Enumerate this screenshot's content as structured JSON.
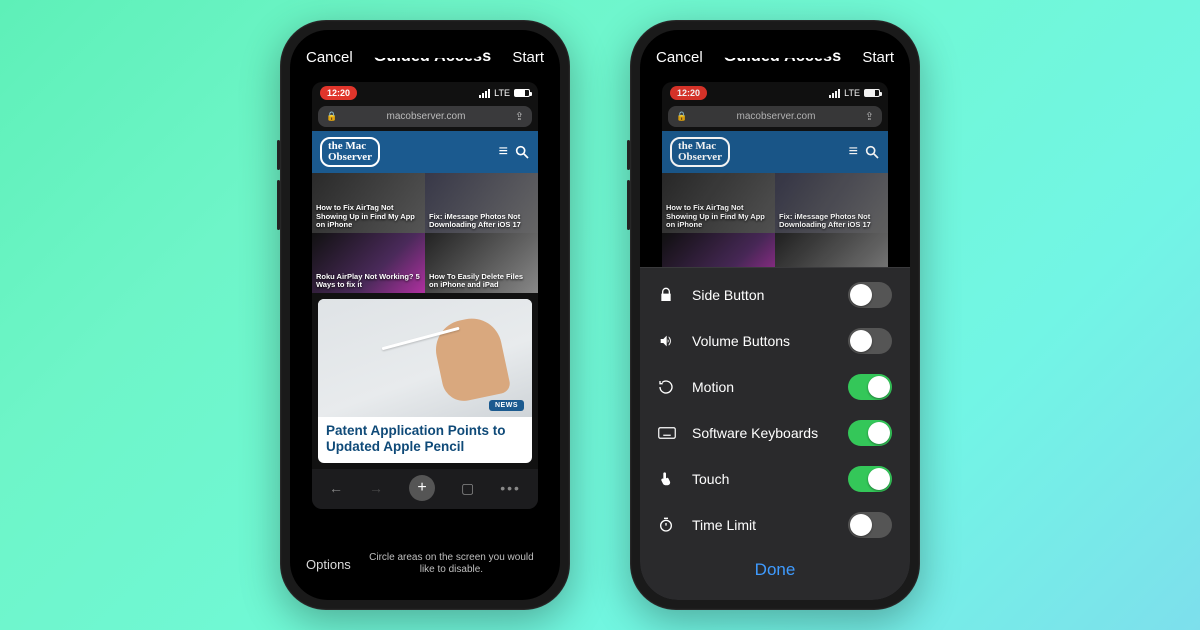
{
  "header": {
    "cancel": "Cancel",
    "title": "Guided Access",
    "start": "Start"
  },
  "status": {
    "time": "12:20",
    "carrier": "LTE"
  },
  "address_bar": {
    "url": "macobserver.com"
  },
  "logo": {
    "top": "the Mac",
    "bottom": "Observer"
  },
  "tiles": [
    {
      "caption": "How to Fix AirTag Not Showing Up in Find My App on iPhone"
    },
    {
      "caption": "Fix: iMessage Photos Not Downloading After iOS 17"
    },
    {
      "caption": "Roku AirPlay Not Working? 5 Ways to fix it"
    },
    {
      "caption": "How To Easily Delete Files on iPhone and iPad"
    }
  ],
  "feature": {
    "badge": "NEWS",
    "headline": "Patent Application Points to Updated Apple Pencil"
  },
  "footer": {
    "options": "Options",
    "hint": "Circle areas on the screen you would like to disable."
  },
  "options": [
    {
      "icon": "lock",
      "label": "Side Button",
      "on": false
    },
    {
      "icon": "volume",
      "label": "Volume Buttons",
      "on": false
    },
    {
      "icon": "motion",
      "label": "Motion",
      "on": true
    },
    {
      "icon": "keyboard",
      "label": "Software Keyboards",
      "on": true
    },
    {
      "icon": "touch",
      "label": "Touch",
      "on": true
    },
    {
      "icon": "timer",
      "label": "Time Limit",
      "on": false
    }
  ],
  "done": "Done"
}
